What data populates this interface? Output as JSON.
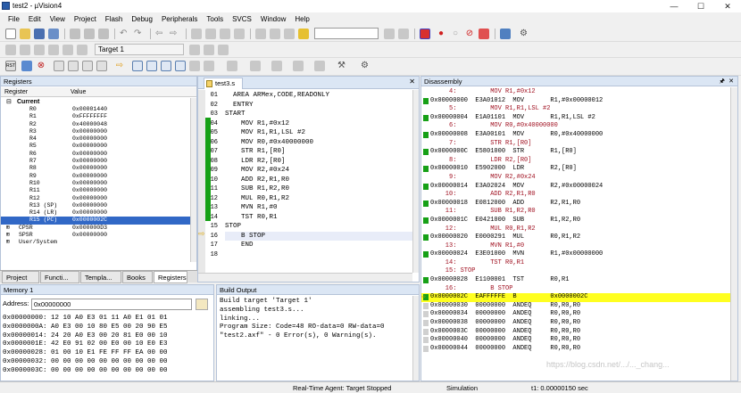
{
  "window": {
    "title": "test2 - µVision4"
  },
  "menu": [
    "File",
    "Edit",
    "View",
    "Project",
    "Flash",
    "Debug",
    "Peripherals",
    "Tools",
    "SVCS",
    "Window",
    "Help"
  ],
  "toolbar": {
    "target": "Target 1"
  },
  "registers": {
    "title": "Registers",
    "col_register": "Register",
    "col_value": "Value",
    "group": "Current",
    "rows": [
      {
        "name": "R0",
        "value": "0x00001440"
      },
      {
        "name": "R1",
        "value": "0xFFFFFFFF"
      },
      {
        "name": "R2",
        "value": "0x40000048"
      },
      {
        "name": "R3",
        "value": "0x00000000"
      },
      {
        "name": "R4",
        "value": "0x00000000"
      },
      {
        "name": "R5",
        "value": "0x00000000"
      },
      {
        "name": "R6",
        "value": "0x00000000"
      },
      {
        "name": "R7",
        "value": "0x00000000"
      },
      {
        "name": "R8",
        "value": "0x00000000"
      },
      {
        "name": "R9",
        "value": "0x00000000"
      },
      {
        "name": "R10",
        "value": "0x00000000"
      },
      {
        "name": "R11",
        "value": "0x00000000"
      },
      {
        "name": "R12",
        "value": "0x00000000"
      },
      {
        "name": "R13 (SP)",
        "value": "0x00000000"
      },
      {
        "name": "R14 (LR)",
        "value": "0x00000000"
      },
      {
        "name": "R15 (PC)",
        "value": "0x0000002C"
      },
      {
        "name": "CPSR",
        "value": "0x000000D3"
      },
      {
        "name": "SPSR",
        "value": "0x00000000"
      },
      {
        "name": "User/System",
        "value": ""
      }
    ],
    "tabs": [
      "Project",
      "Functi...",
      "Templa...",
      "Books",
      "Registers"
    ]
  },
  "editor": {
    "tab": "test3.s",
    "lines": [
      {
        "n": "01",
        "t": "  AREA ARMex,CODE,READONLY"
      },
      {
        "n": "02",
        "t": "  ENTRY"
      },
      {
        "n": "03",
        "t": "START"
      },
      {
        "n": "04",
        "t": "    MOV R1,#0x12"
      },
      {
        "n": "05",
        "t": "    MOV R1,R1,LSL #2"
      },
      {
        "n": "06",
        "t": "    MOV R0,#0x40000000"
      },
      {
        "n": "07",
        "t": "    STR R1,[R0]"
      },
      {
        "n": "08",
        "t": "    LDR R2,[R0]"
      },
      {
        "n": "09",
        "t": "    MOV R2,#0x24"
      },
      {
        "n": "10",
        "t": "    ADD R2,R1,R0"
      },
      {
        "n": "11",
        "t": "    SUB R1,R2,R0"
      },
      {
        "n": "12",
        "t": "    MUL R0,R1,R2"
      },
      {
        "n": "13",
        "t": "    MVN R1,#0"
      },
      {
        "n": "14",
        "t": "    TST R0,R1"
      },
      {
        "n": "15",
        "t": "STOP"
      },
      {
        "n": "16",
        "t": "    B STOP"
      },
      {
        "n": "17",
        "t": "    END"
      },
      {
        "n": "18",
        "t": ""
      }
    ]
  },
  "disassembly": {
    "title": "Disassembly",
    "lines": [
      {
        "k": "src",
        "t": "     4:         MOV R1,#0x12"
      },
      {
        "k": "asm",
        "t": "0x00000000  E3A01012  MOV       R1,#0x00000012"
      },
      {
        "k": "src",
        "t": "     5:         MOV R1,R1,LSL #2"
      },
      {
        "k": "asm",
        "t": "0x00000004  E1A01101  MOV       R1,R1,LSL #2"
      },
      {
        "k": "src",
        "t": "     6:         MOV R0,#0x40000000"
      },
      {
        "k": "asm",
        "t": "0x00000008  E3A00101  MOV       R0,#0x40000000"
      },
      {
        "k": "src",
        "t": "     7:         STR R1,[R0]"
      },
      {
        "k": "asm",
        "t": "0x0000000C  E5801000  STR       R1,[R0]"
      },
      {
        "k": "src",
        "t": "     8:         LDR R2,[R0]"
      },
      {
        "k": "asm",
        "t": "0x00000010  E5902000  LDR       R2,[R0]"
      },
      {
        "k": "src",
        "t": "     9:         MOV R2,#0x24"
      },
      {
        "k": "asm",
        "t": "0x00000014  E3A02024  MOV       R2,#0x00000024"
      },
      {
        "k": "src",
        "t": "    10:         ADD R2,R1,R0"
      },
      {
        "k": "asm",
        "t": "0x00000018  E0812000  ADD       R2,R1,R0"
      },
      {
        "k": "src",
        "t": "    11:         SUB R1,R2,R0"
      },
      {
        "k": "asm",
        "t": "0x0000001C  E0421000  SUB       R1,R2,R0"
      },
      {
        "k": "src",
        "t": "    12:         MUL R0,R1,R2"
      },
      {
        "k": "asm",
        "t": "0x00000020  E0000291  MUL       R0,R1,R2"
      },
      {
        "k": "src",
        "t": "    13:         MVN R1,#0"
      },
      {
        "k": "asm",
        "t": "0x00000024  E3E01000  MVN       R1,#0x00000000"
      },
      {
        "k": "src",
        "t": "    14:         TST R0,R1"
      },
      {
        "k": "src",
        "t": "    15: STOP"
      },
      {
        "k": "asm",
        "t": "0x00000028  E1100001  TST       R0,R1"
      },
      {
        "k": "src",
        "t": "    16:         B STOP"
      },
      {
        "k": "cur",
        "t": "0x0000002C  EAFFFFFE  B         0x0000002C"
      },
      {
        "k": "asm",
        "t": "0x00000030  00000000  ANDEQ     R0,R0,R0"
      },
      {
        "k": "asm",
        "t": "0x00000034  00000000  ANDEQ     R0,R0,R0"
      },
      {
        "k": "asm",
        "t": "0x00000038  00000000  ANDEQ     R0,R0,R0"
      },
      {
        "k": "asm",
        "t": "0x0000003C  00000000  ANDEQ     R0,R0,R0"
      },
      {
        "k": "asm",
        "t": "0x00000040  00000000  ANDEQ     R0,R0,R0"
      },
      {
        "k": "asm",
        "t": "0x00000044  00000000  ANDEQ     R0,R0,R0"
      }
    ],
    "watermark": "https://blog.csdn.net/.../..._chang..."
  },
  "memory": {
    "title": "Memory 1",
    "address_label": "Address:",
    "address_value": "0x00000000",
    "lines": [
      "0x00000000: 12 10 A0 E3 01 11 A0 E1 01 01",
      "0x0000000A: A0 E3 00 10 80 E5 00 20 90 E5",
      "0x00000014: 24 20 A0 E3 00 20 81 E0 00 10",
      "0x0000001E: 42 E0 91 02 00 E0 00 10 E0 E3",
      "0x00000028: 01 00 10 E1 FE FF FF EA 00 00",
      "0x00000032: 00 00 00 00 00 00 00 00 00 00",
      "0x0000003C: 00 00 00 00 00 00 00 00 00 00"
    ]
  },
  "build": {
    "title": "Build Output",
    "lines": [
      "Build target 'Target 1'",
      "assembling test3.s...",
      "linking...",
      "Program Size: Code=48 RO-data=0 RW-data=0",
      "\"test2.axf\" - 0 Error(s), 0 Warning(s)."
    ]
  },
  "status": {
    "agent": "Real-Time Agent: Target Stopped",
    "mode": "Simulation",
    "time": "t1: 0.00000150 sec"
  }
}
